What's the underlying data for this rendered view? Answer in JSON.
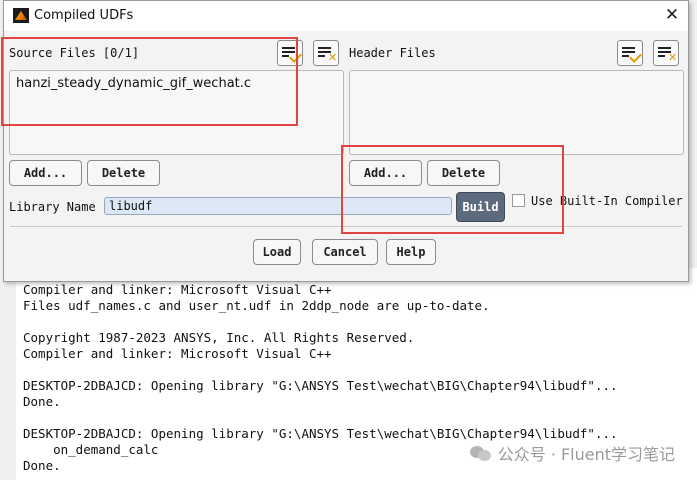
{
  "dialog": {
    "title": "Compiled UDFs",
    "close_glyph": "✕",
    "source_files_label": "Source Files [0/1]",
    "source_files": [
      "hanzi_steady_dynamic_gif_wechat.c"
    ],
    "header_files_label": "Header Files",
    "header_files": [],
    "add_label": "Add...",
    "delete_label": "Delete",
    "library_name_label": "Library Name",
    "library_name_value": "libudf",
    "build_label": "Build",
    "use_builtin_label": "Use Built-In Compiler",
    "use_builtin_checked": false,
    "load_label": "Load",
    "cancel_label": "Cancel",
    "help_label": "Help"
  },
  "console": {
    "lines": [
      "Compiler and linker: Microsoft Visual C++",
      "Files udf_names.c and user_nt.udf in 2ddp_node are up-to-date.",
      "",
      "Copyright 1987-2023 ANSYS, Inc. All Rights Reserved.",
      "Compiler and linker: Microsoft Visual C++",
      "",
      "DESKTOP-2DBAJCD: Opening library \"G:\\ANSYS Test\\wechat\\BIG\\Chapter94\\libudf\"...",
      "Done.",
      "",
      "DESKTOP-2DBAJCD: Opening library \"G:\\ANSYS Test\\wechat\\BIG\\Chapter94\\libudf\"...",
      "    on_demand_calc",
      "Done."
    ]
  },
  "watermark": {
    "text": "公众号 · Fluent学习笔记"
  },
  "colors": {
    "highlight": "#e0463f",
    "build_button": "#5c6a7e"
  }
}
